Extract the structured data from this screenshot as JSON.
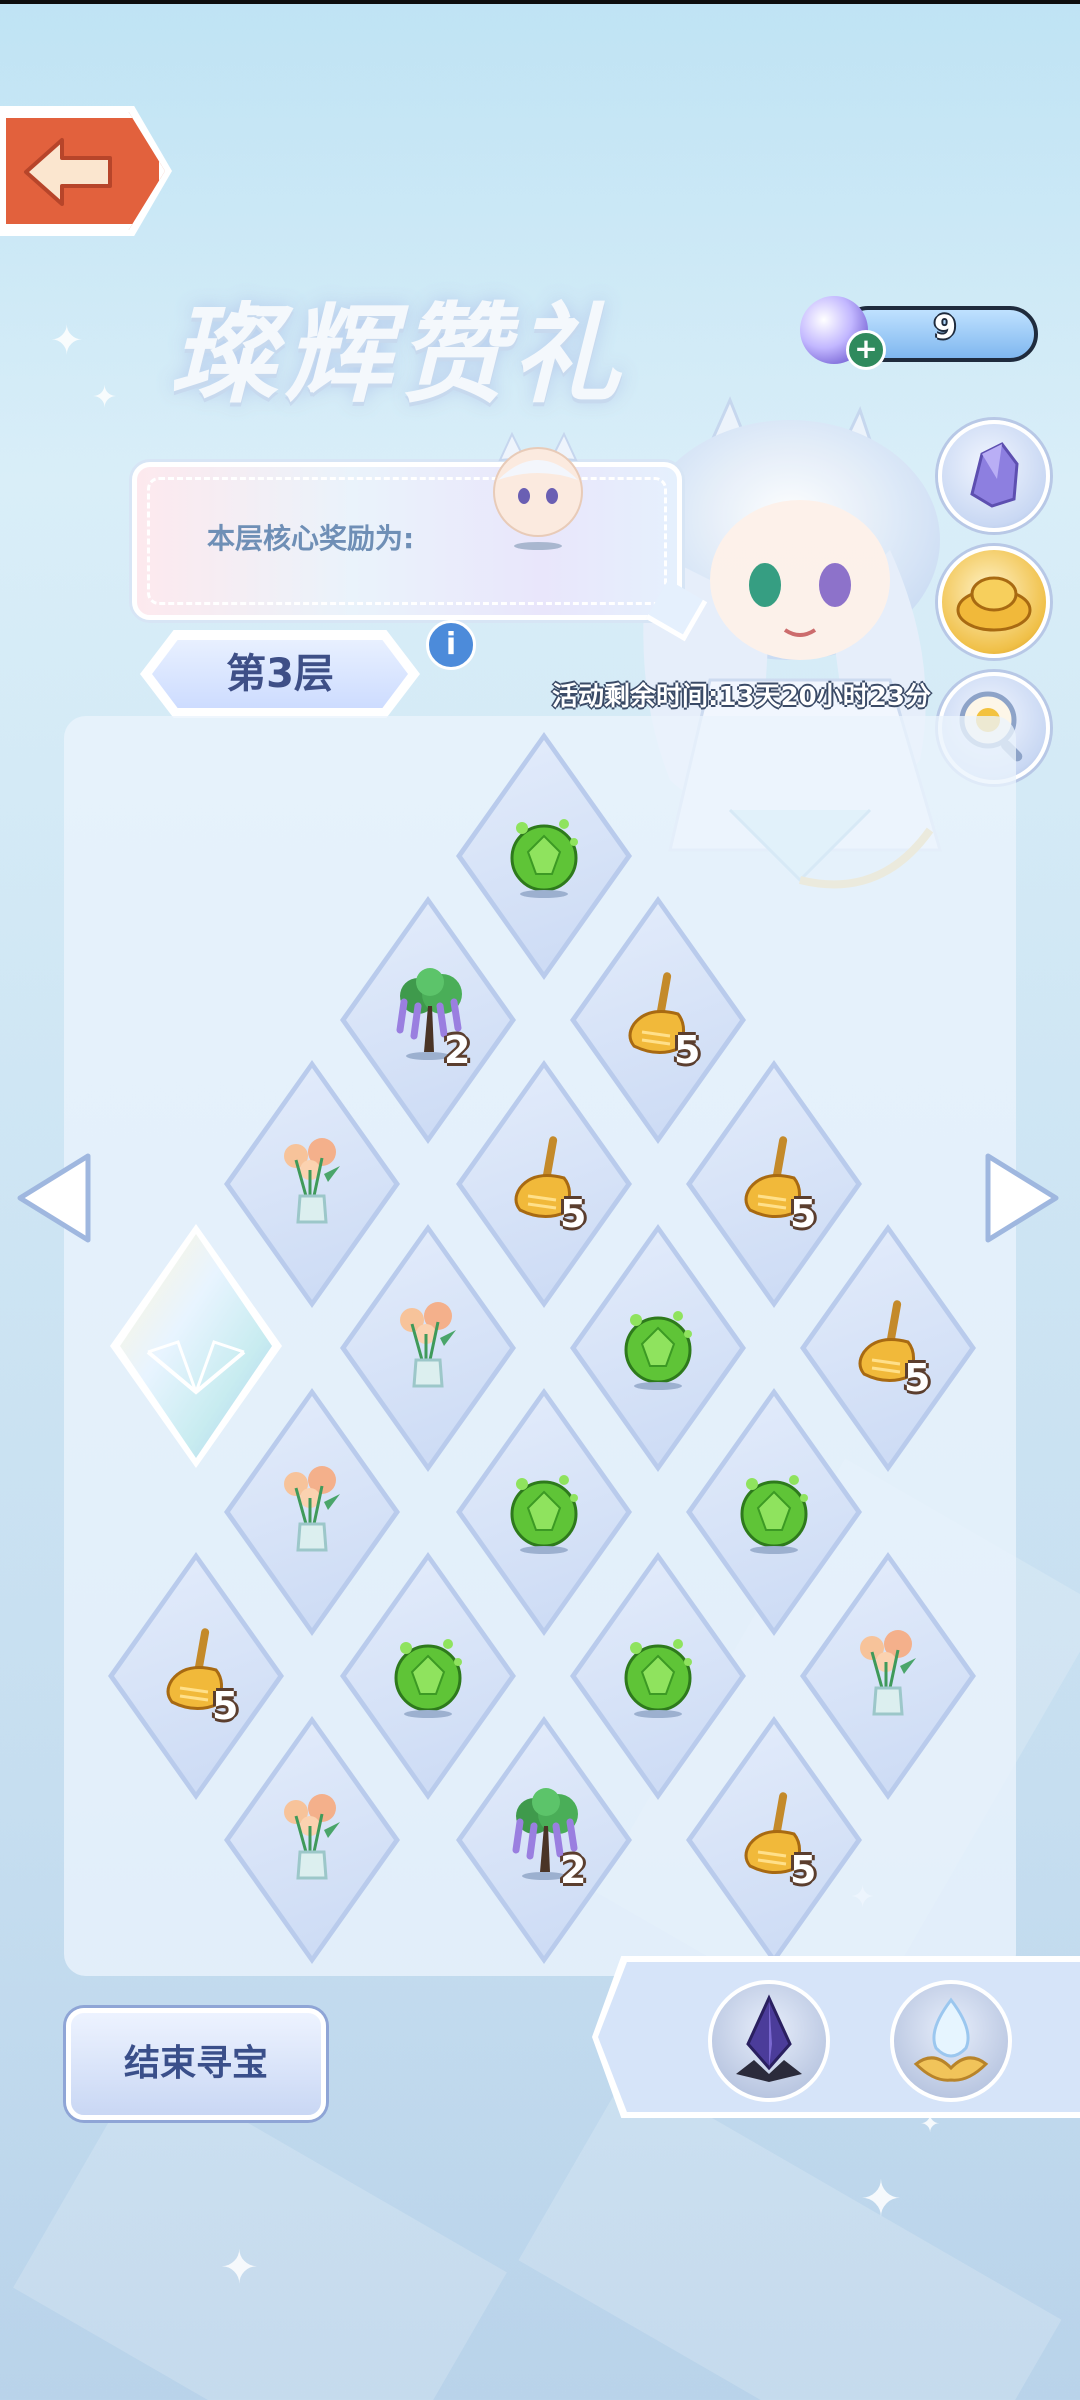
{
  "header": {
    "title": "璨辉赞礼",
    "currency_value": "9",
    "currency_plus": "+"
  },
  "reward": {
    "label": "本层核心奖励为:"
  },
  "floor": {
    "label": "第3层",
    "info": "i"
  },
  "timer": {
    "text": "活动剩余时间:13天20小时23分"
  },
  "board": {
    "tiles": [
      {
        "item": "green-orb-icon",
        "count": ""
      },
      {
        "item": "wisteria-tree-icon",
        "count": "2"
      },
      {
        "item": "broom-icon",
        "count": "5"
      },
      {
        "item": "flower-vase-icon",
        "count": ""
      },
      {
        "item": "broom-icon",
        "count": "5"
      },
      {
        "item": "broom-icon",
        "count": "5"
      },
      {
        "item": "flower-vase-icon",
        "count": ""
      },
      {
        "item": "green-orb-icon",
        "count": ""
      },
      {
        "item": "broom-icon",
        "count": "5"
      },
      {
        "item": "flower-vase-icon",
        "count": ""
      },
      {
        "item": "green-orb-icon",
        "count": ""
      },
      {
        "item": "green-orb-icon",
        "count": ""
      },
      {
        "item": "broom-icon",
        "count": "5"
      },
      {
        "item": "green-orb-icon",
        "count": ""
      },
      {
        "item": "green-orb-icon",
        "count": ""
      },
      {
        "item": "flower-vase-icon",
        "count": ""
      },
      {
        "item": "flower-vase-icon",
        "count": ""
      },
      {
        "item": "wisteria-tree-icon",
        "count": "2"
      },
      {
        "item": "broom-icon",
        "count": "5"
      }
    ]
  },
  "footer": {
    "end_button": "结束寻宝"
  },
  "colors": {
    "back_button": "#e2613d",
    "accent_blue": "#4c8bda",
    "count_outline": "#5b3e2e",
    "orb_green": "#5fc437",
    "broom_gold": "#f1b93a"
  }
}
